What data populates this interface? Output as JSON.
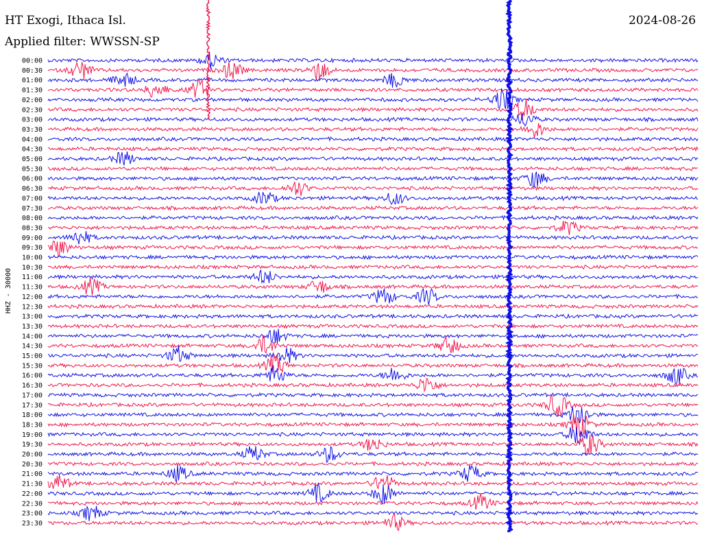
{
  "header": {
    "station": "HT Exogi, Ithaca Isl.",
    "date": "2024-08-26",
    "filter_label": "Applied filter: WWSSN-SP"
  },
  "axis": {
    "ylabel": "HHZ - 30000"
  },
  "colors": {
    "series_a": "#0f0fe6",
    "series_b": "#f0144c",
    "background": "#ffffff"
  },
  "chart_data": {
    "type": "line",
    "chart_kind": "helicorder seismogram",
    "rows": [
      "00:00",
      "00:30",
      "01:00",
      "01:30",
      "02:00",
      "02:30",
      "03:00",
      "03:30",
      "04:00",
      "04:30",
      "05:00",
      "05:30",
      "06:00",
      "06:30",
      "07:00",
      "07:30",
      "08:00",
      "08:30",
      "09:00",
      "09:30",
      "10:00",
      "10:30",
      "11:00",
      "11:30",
      "12:00",
      "12:30",
      "13:00",
      "13:30",
      "14:00",
      "14:30",
      "15:00",
      "15:30",
      "16:00",
      "16:30",
      "17:00",
      "17:30",
      "18:00",
      "18:30",
      "19:00",
      "19:30",
      "20:00",
      "20:30",
      "21:00",
      "21:30",
      "22:00",
      "22:30",
      "23:00",
      "23:30"
    ],
    "row_color_order": [
      "blue",
      "red"
    ],
    "minutes_per_row": 30,
    "events": [
      {
        "row": "00:00",
        "minute": 7.5,
        "amp": 1.0
      },
      {
        "row": "00:30",
        "minute": 1.5,
        "amp": 1.2
      },
      {
        "row": "00:30",
        "minute": 8.5,
        "amp": 1.1
      },
      {
        "row": "00:30",
        "minute": 12.5,
        "amp": 1.3
      },
      {
        "row": "01:00",
        "minute": 3.5,
        "amp": 1.0
      },
      {
        "row": "01:00",
        "minute": 16.0,
        "amp": 0.9
      },
      {
        "row": "01:30",
        "minute": 5.0,
        "amp": 1.1
      },
      {
        "row": "01:30",
        "minute": 7.0,
        "amp": 1.2
      },
      {
        "row": "02:00",
        "minute": 21.0,
        "amp": 1.4
      },
      {
        "row": "02:30",
        "minute": 22.0,
        "amp": 1.3
      },
      {
        "row": "03:00",
        "minute": 22.0,
        "amp": 0.9
      },
      {
        "row": "03:30",
        "minute": 22.5,
        "amp": 1.0
      },
      {
        "row": "05:00",
        "minute": 3.5,
        "amp": 0.9
      },
      {
        "row": "06:00",
        "minute": 22.5,
        "amp": 1.1
      },
      {
        "row": "06:30",
        "minute": 11.5,
        "amp": 1.0
      },
      {
        "row": "07:00",
        "minute": 10.0,
        "amp": 0.9
      },
      {
        "row": "07:00",
        "minute": 16.0,
        "amp": 0.8
      },
      {
        "row": "08:30",
        "minute": 24.0,
        "amp": 0.9
      },
      {
        "row": "09:00",
        "minute": 1.5,
        "amp": 1.0
      },
      {
        "row": "09:30",
        "minute": 0.5,
        "amp": 1.1
      },
      {
        "row": "11:00",
        "minute": 10.0,
        "amp": 0.9
      },
      {
        "row": "11:30",
        "minute": 2.0,
        "amp": 1.0
      },
      {
        "row": "11:30",
        "minute": 12.5,
        "amp": 0.9
      },
      {
        "row": "12:00",
        "minute": 15.5,
        "amp": 1.1
      },
      {
        "row": "12:00",
        "minute": 17.5,
        "amp": 1.0
      },
      {
        "row": "14:00",
        "minute": 10.5,
        "amp": 1.0
      },
      {
        "row": "14:30",
        "minute": 10.0,
        "amp": 1.2
      },
      {
        "row": "14:30",
        "minute": 18.5,
        "amp": 1.2
      },
      {
        "row": "15:00",
        "minute": 6.0,
        "amp": 1.1
      },
      {
        "row": "15:00",
        "minute": 11.0,
        "amp": 1.0
      },
      {
        "row": "15:30",
        "minute": 10.5,
        "amp": 1.3
      },
      {
        "row": "16:00",
        "minute": 10.5,
        "amp": 1.2
      },
      {
        "row": "16:00",
        "minute": 16.0,
        "amp": 1.0
      },
      {
        "row": "16:00",
        "minute": 29.0,
        "amp": 1.2
      },
      {
        "row": "16:30",
        "minute": 17.5,
        "amp": 1.1
      },
      {
        "row": "17:30",
        "minute": 23.5,
        "amp": 1.5
      },
      {
        "row": "18:00",
        "minute": 24.5,
        "amp": 1.6
      },
      {
        "row": "18:30",
        "minute": 24.5,
        "amp": 1.7
      },
      {
        "row": "19:00",
        "minute": 24.5,
        "amp": 1.6
      },
      {
        "row": "19:30",
        "minute": 25.0,
        "amp": 1.4
      },
      {
        "row": "19:30",
        "minute": 15.0,
        "amp": 0.9
      },
      {
        "row": "20:00",
        "minute": 9.5,
        "amp": 1.0
      },
      {
        "row": "20:00",
        "minute": 13.0,
        "amp": 1.0
      },
      {
        "row": "21:00",
        "minute": 6.0,
        "amp": 1.0
      },
      {
        "row": "21:00",
        "minute": 19.5,
        "amp": 1.1
      },
      {
        "row": "21:30",
        "minute": 15.5,
        "amp": 1.2
      },
      {
        "row": "21:30",
        "minute": 0.5,
        "amp": 1.1
      },
      {
        "row": "22:00",
        "minute": 12.5,
        "amp": 1.1
      },
      {
        "row": "22:00",
        "minute": 15.5,
        "amp": 1.3
      },
      {
        "row": "22:30",
        "minute": 20.0,
        "amp": 1.0
      },
      {
        "row": "23:00",
        "minute": 2.0,
        "amp": 1.0
      },
      {
        "row": "23:30",
        "minute": 16.0,
        "amp": 1.0
      }
    ],
    "spikes": [
      {
        "row": "00:00",
        "minute": 7.4,
        "height_rows": 6
      },
      {
        "row": "00:00",
        "minute": 21.3,
        "height_rows": 48
      }
    ]
  }
}
